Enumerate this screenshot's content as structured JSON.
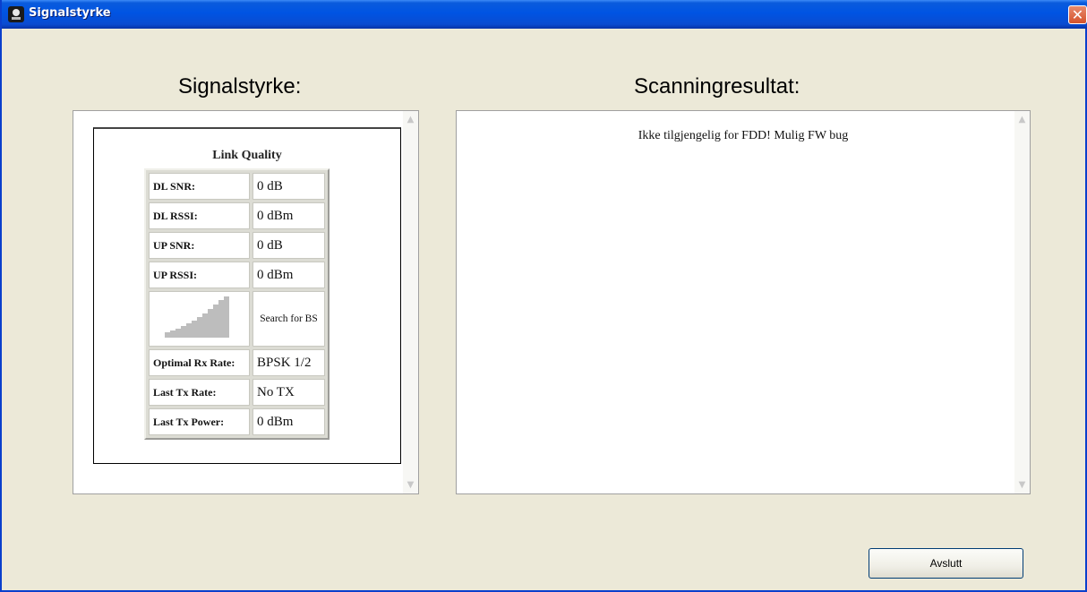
{
  "window": {
    "title": "Signalstyrke",
    "close_glyph": "✕"
  },
  "left": {
    "heading": "Signalstyrke:",
    "link_quality": {
      "title": "Link Quality",
      "rows": [
        {
          "label": "DL SNR:",
          "value": "0 dB"
        },
        {
          "label": "DL RSSI:",
          "value": "0 dBm"
        },
        {
          "label": "UP SNR:",
          "value": "0 dB"
        },
        {
          "label": "UP RSSI:",
          "value": "0 dBm"
        }
      ],
      "signal": {
        "icon": "signal-bars-icon",
        "status": "Search for BS"
      },
      "rows2": [
        {
          "label": "Optimal Rx Rate:",
          "value": "BPSK 1/2"
        },
        {
          "label": "Last Tx Rate:",
          "value": "No TX"
        },
        {
          "label": "Last Tx Power:",
          "value": "0 dBm"
        }
      ]
    }
  },
  "right": {
    "heading": "Scanningresultat:",
    "message": "Ikke tilgjengelig for FDD! Mulig FW bug"
  },
  "buttons": {
    "exit": "Avslutt"
  },
  "colors": {
    "titlebar": "#0054e3",
    "background": "#ece9d8",
    "close": "#d4522b"
  }
}
